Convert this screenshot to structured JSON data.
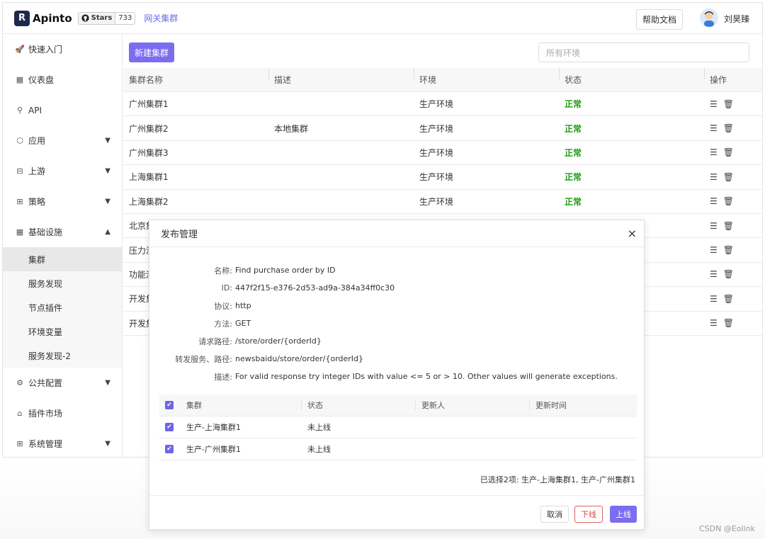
{
  "header": {
    "logo_letter": "R",
    "logo_text": "Apinto",
    "github_label": "Stars",
    "github_count": "733",
    "breadcrumb": "网关集群",
    "help_label": "帮助文档",
    "username": "刘昊臻"
  },
  "sidebar": {
    "items": [
      {
        "label": "快速入门",
        "icon": "rocket-icon"
      },
      {
        "label": "仪表盘",
        "icon": "dashboard-icon"
      },
      {
        "label": "API",
        "icon": "api-icon"
      },
      {
        "label": "应用",
        "icon": "app-icon"
      },
      {
        "label": "上游",
        "icon": "upstream-icon"
      },
      {
        "label": "策略",
        "icon": "strategy-icon"
      },
      {
        "label": "基础设施",
        "icon": "infrastructure-icon"
      }
    ],
    "sub_items": [
      "集群",
      "服务发现",
      "节点插件",
      "环境变量",
      "服务发现-2"
    ],
    "bottom_items": [
      {
        "label": "公共配置",
        "icon": "common-config-icon"
      },
      {
        "label": "插件市场",
        "icon": "plugin-market-icon"
      },
      {
        "label": "系统管理",
        "icon": "system-icon"
      }
    ]
  },
  "main": {
    "new_button": "新建集群",
    "env_placeholder": "所有环境",
    "columns": [
      "集群名称",
      "描述",
      "环境",
      "状态",
      "操作"
    ],
    "rows": [
      {
        "name": "广州集群1",
        "desc": "",
        "env": "生产环境",
        "status": "正常"
      },
      {
        "name": "广州集群2",
        "desc": "本地集群",
        "env": "生产环境",
        "status": "正常"
      },
      {
        "name": "广州集群3",
        "desc": "",
        "env": "生产环境",
        "status": "正常"
      },
      {
        "name": "上海集群1",
        "desc": "",
        "env": "生产环境",
        "status": "正常"
      },
      {
        "name": "上海集群2",
        "desc": "",
        "env": "生产环境",
        "status": "正常"
      },
      {
        "name": "北京集",
        "desc": "",
        "env": "",
        "status": ""
      },
      {
        "name": "压力测",
        "desc": "",
        "env": "",
        "status": ""
      },
      {
        "name": "功能测",
        "desc": "",
        "env": "",
        "status": ""
      },
      {
        "name": "开发集",
        "desc": "",
        "env": "",
        "status": ""
      },
      {
        "name": "开发集",
        "desc": "",
        "env": "",
        "status": ""
      }
    ]
  },
  "modal": {
    "title": "发布管理",
    "close": "×",
    "info": [
      {
        "k": "名称:",
        "v": "Find purchase order by ID"
      },
      {
        "k": "ID:",
        "v": "447f2f15-e376-2d53-ad9a-384a34ff0c30"
      },
      {
        "k": "协议:",
        "v": "http"
      },
      {
        "k": "方法:",
        "v": "GET"
      },
      {
        "k": "请求路径:",
        "v": "/store/order/{orderId}"
      },
      {
        "k": "转发服务、路径:",
        "v": "newsbaidu/store/order/{orderId}"
      },
      {
        "k": "描述:",
        "v": "For valid response try integer IDs with value <= 5 or > 10. Other values will generate exceptions."
      }
    ],
    "table_columns": [
      "集群",
      "状态",
      "更新人",
      "更新时间"
    ],
    "table_rows": [
      {
        "cluster": "生产-上海集群1",
        "status": "未上线",
        "updater": "",
        "time": ""
      },
      {
        "cluster": "生产-广州集群1",
        "status": "未上线",
        "updater": "",
        "time": ""
      }
    ],
    "selected_info": "已选择2项: 生产-上海集群1, 生产-广州集群1",
    "cancel": "取消",
    "offline": "下线",
    "online": "上线"
  },
  "watermark": "CSDN @Eolink"
}
